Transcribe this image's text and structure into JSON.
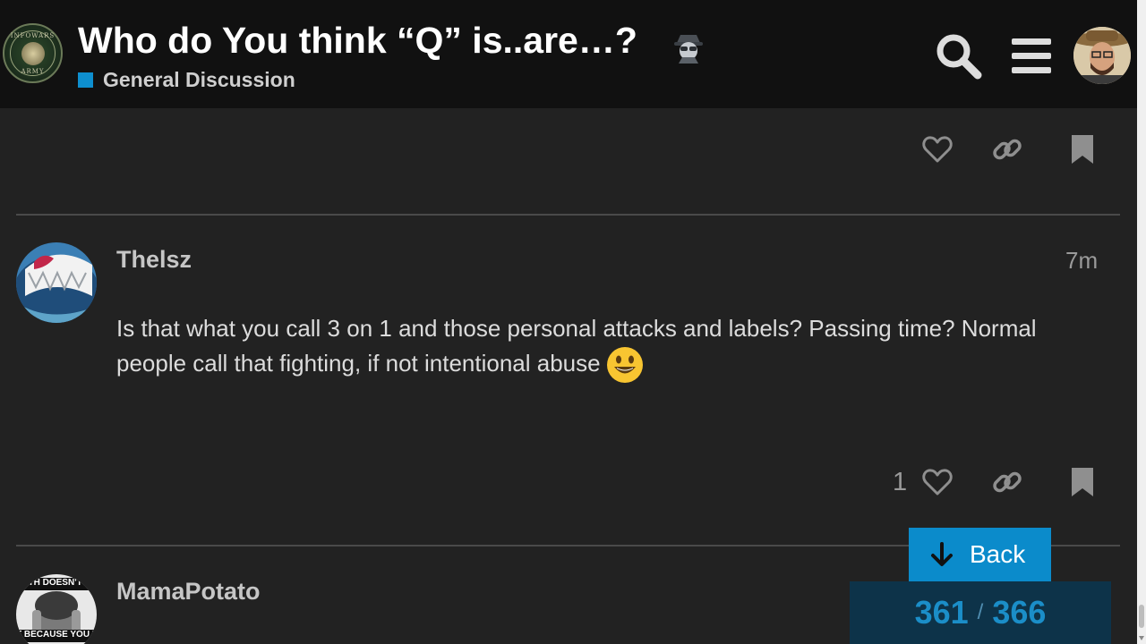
{
  "header": {
    "logo_text_top": "INFOWARS",
    "logo_text_bottom": "ARMY",
    "title": "Who do You think “Q” is..are…?",
    "title_icon": "spy-emoji-icon",
    "category": "General Discussion",
    "category_color": "#0e8fcf",
    "search_icon": "search-icon",
    "menu_icon": "hamburger-menu-icon"
  },
  "posts": [
    {
      "username": "Thelsz",
      "time": "7m",
      "body": "Is that what you call 3 on 1 and those personal attacks and labels? Passing time? Normal people call that fighting, if not intentional abuse",
      "emoji": "smiley-icon",
      "like_count": "1"
    },
    {
      "username": "MamaPotato",
      "avatar_text_top": "UTH DOESN'T C",
      "avatar_text_bottom": "T BECAUSE YOU DO"
    }
  ],
  "back_button": {
    "label": "Back"
  },
  "progress": {
    "current": "361",
    "separator": "/",
    "total": "366"
  },
  "colors": {
    "accent": "#0b8bcb",
    "background": "#222222",
    "header": "#111111"
  }
}
